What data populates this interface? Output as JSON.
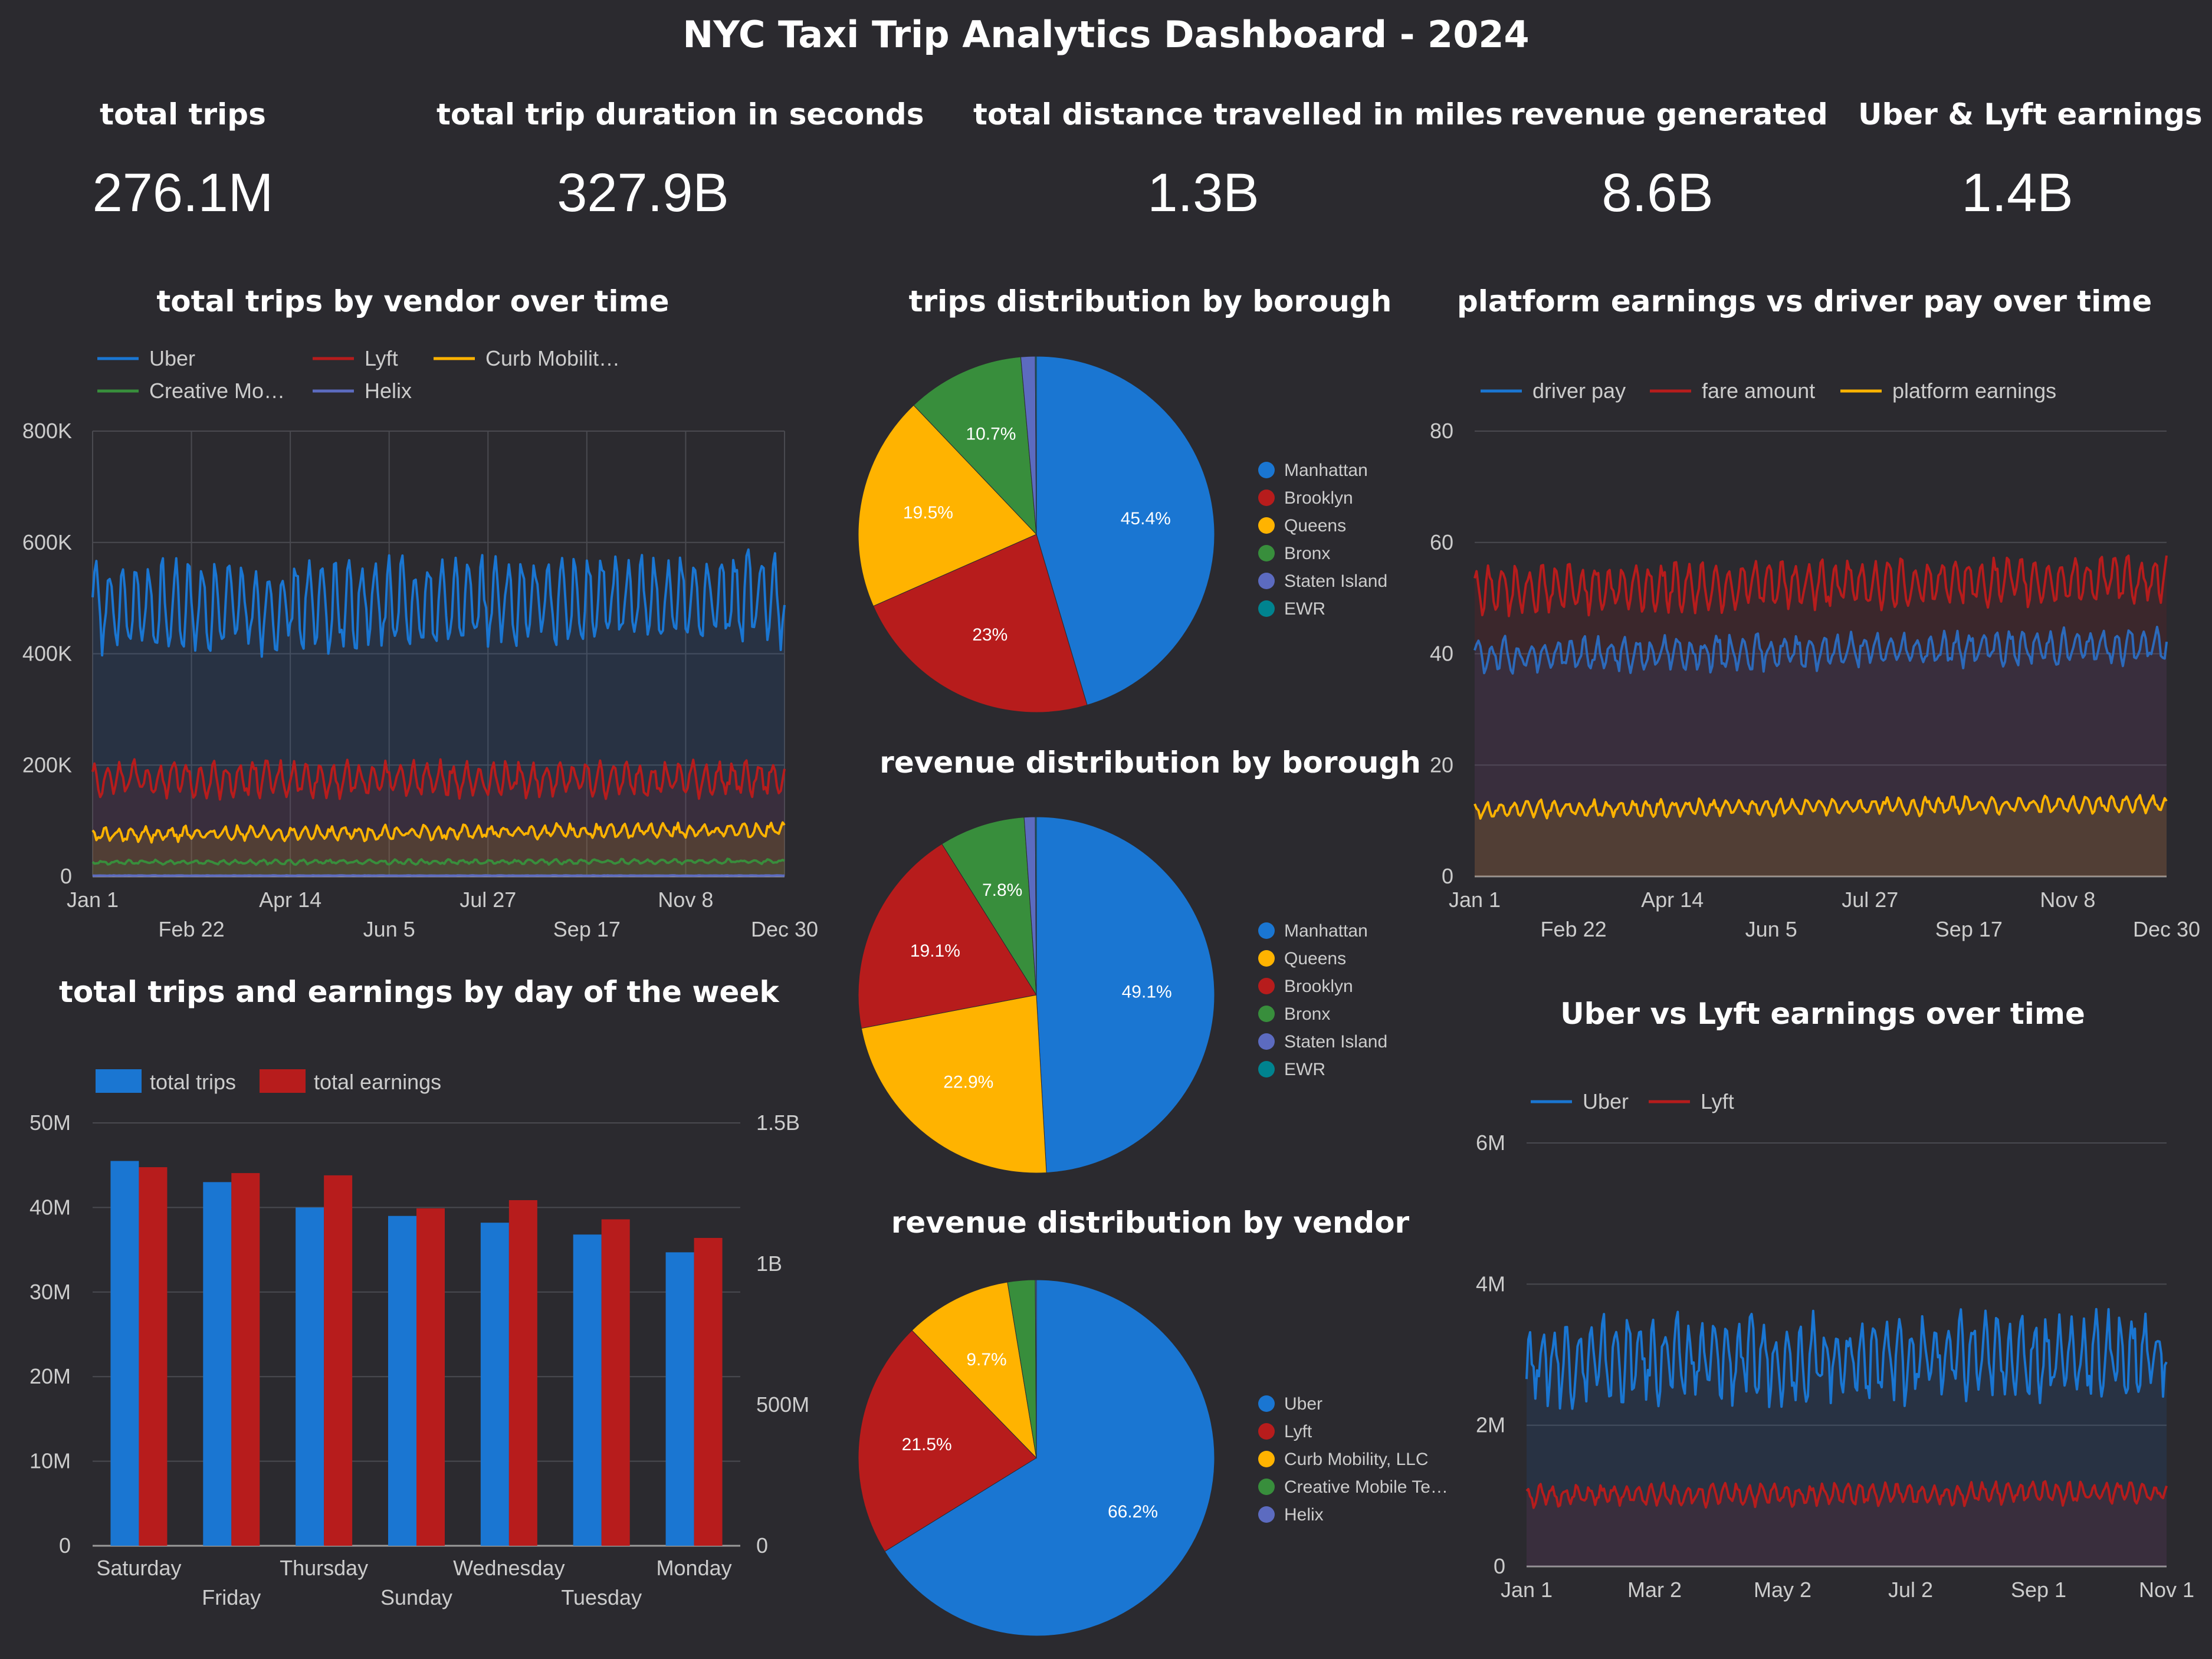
{
  "dashboard": {
    "title": "NYC Taxi Trip Analytics Dashboard - 2024",
    "kpis": [
      {
        "label": "total trips",
        "value": "276.1M"
      },
      {
        "label": "total trip duration in seconds",
        "value": "327.9B"
      },
      {
        "label": "total distance travelled in miles",
        "value": "1.3B"
      },
      {
        "label": "revenue generated",
        "value": "8.6B"
      },
      {
        "label": "Uber & Lyft earnings",
        "value": "1.4B"
      }
    ]
  },
  "colors": {
    "background": "#2b2a2f",
    "blue": "#1a76d2",
    "red": "#b71c1c",
    "yellow": "#ffb300",
    "green": "#388e3c",
    "purple": "#5c6bc0",
    "teal": "#00838f",
    "grid": "#4a4a50",
    "axis_text": "#cccccc"
  },
  "chart_data": [
    {
      "id": "trips_by_vendor",
      "type": "line",
      "title": "total trips by vendor over time",
      "x_ticks": [
        "Jan 1",
        "Feb 22",
        "Apr 14",
        "Jun 5",
        "Jul 27",
        "Sep 17",
        "Nov 8",
        "Dec 30"
      ],
      "y_ticks": [
        "0",
        "200K",
        "400K",
        "600K",
        "800K"
      ],
      "ylim": [
        0,
        800000
      ],
      "grid": true,
      "legend_position": "top",
      "series": [
        {
          "name": "Uber",
          "color": "#1a76d2",
          "base": 480000,
          "weekly_amp": 70000,
          "noise": 25000,
          "trend": 20000
        },
        {
          "name": "Lyft",
          "color": "#b71c1c",
          "base": 175000,
          "weekly_amp": 25000,
          "noise": 12000,
          "trend": 0
        },
        {
          "name": "Curb Mobilit…",
          "color": "#ffb300",
          "base": 75000,
          "weekly_amp": 10000,
          "noise": 6000,
          "trend": 8000
        },
        {
          "name": "Creative Mo…",
          "color": "#388e3c",
          "base": 25000,
          "weekly_amp": 3000,
          "noise": 2000,
          "trend": 2000
        },
        {
          "name": "Helix",
          "color": "#5c6bc0",
          "base": 1500,
          "weekly_amp": 200,
          "noise": 200,
          "trend": 0
        }
      ]
    },
    {
      "id": "trips_by_borough",
      "type": "pie",
      "title": "trips distribution by borough",
      "slices": [
        {
          "label": "Manhattan",
          "value": 45.4,
          "color": "#1a76d2",
          "pct_label": "45.4%"
        },
        {
          "label": "Brooklyn",
          "value": 23.0,
          "color": "#b71c1c",
          "pct_label": "23%"
        },
        {
          "label": "Queens",
          "value": 19.5,
          "color": "#ffb300",
          "pct_label": "19.5%"
        },
        {
          "label": "Bronx",
          "value": 10.7,
          "color": "#388e3c",
          "pct_label": "10.7%"
        },
        {
          "label": "Staten Island",
          "value": 1.3,
          "color": "#5c6bc0",
          "pct_label": ""
        },
        {
          "label": "EWR",
          "value": 0.1,
          "color": "#00838f",
          "pct_label": ""
        }
      ]
    },
    {
      "id": "revenue_by_borough",
      "type": "pie",
      "title": "revenue distribution by borough",
      "slices": [
        {
          "label": "Manhattan",
          "value": 49.1,
          "color": "#1a76d2",
          "pct_label": "49.1%"
        },
        {
          "label": "Queens",
          "value": 22.9,
          "color": "#ffb300",
          "pct_label": "22.9%"
        },
        {
          "label": "Brooklyn",
          "value": 19.1,
          "color": "#b71c1c",
          "pct_label": "19.1%"
        },
        {
          "label": "Bronx",
          "value": 7.8,
          "color": "#388e3c",
          "pct_label": "7.8%"
        },
        {
          "label": "Staten Island",
          "value": 1.0,
          "color": "#5c6bc0",
          "pct_label": ""
        },
        {
          "label": "EWR",
          "value": 0.1,
          "color": "#00838f",
          "pct_label": ""
        }
      ]
    },
    {
      "id": "revenue_by_vendor",
      "type": "pie",
      "title": "revenue distribution by vendor",
      "slices": [
        {
          "label": "Uber",
          "value": 66.2,
          "color": "#1a76d2",
          "pct_label": "66.2%"
        },
        {
          "label": "Lyft",
          "value": 21.5,
          "color": "#b71c1c",
          "pct_label": "21.5%"
        },
        {
          "label": "Curb Mobility, LLC",
          "value": 9.7,
          "color": "#ffb300",
          "pct_label": "9.7%"
        },
        {
          "label": "Creative Mobile Te…",
          "value": 2.5,
          "color": "#388e3c",
          "pct_label": ""
        },
        {
          "label": "Helix",
          "value": 0.1,
          "color": "#5c6bc0",
          "pct_label": ""
        }
      ]
    },
    {
      "id": "earnings_vs_driver_pay",
      "type": "line",
      "title": "platform earnings vs driver pay over time",
      "x_ticks": [
        "Jan 1",
        "Feb 22",
        "Apr 14",
        "Jun 5",
        "Jul 27",
        "Sep 17",
        "Nov 8",
        "Dec 30"
      ],
      "y_ticks": [
        "0",
        "20",
        "40",
        "60",
        "80"
      ],
      "ylim": [
        0,
        80
      ],
      "grid": true,
      "legend_position": "top",
      "series": [
        {
          "name": "driver pay",
          "color": "#1a76d2",
          "base": 39.5,
          "weekly_amp": 2.5,
          "noise": 1.2,
          "trend": 2
        },
        {
          "name": "fare amount",
          "color": "#b71c1c",
          "base": 51.5,
          "weekly_amp": 3.5,
          "noise": 1.5,
          "trend": 2
        },
        {
          "name": "platform earnings",
          "color": "#ffb300",
          "base": 12,
          "weekly_amp": 1.2,
          "noise": 0.6,
          "trend": 1
        }
      ]
    },
    {
      "id": "trips_earnings_by_weekday",
      "type": "bar",
      "title": "total trips and earnings by day of the week",
      "categories": [
        "Saturday",
        "Friday",
        "Thursday",
        "Sunday",
        "Wednesday",
        "Tuesday",
        "Monday"
      ],
      "y_ticks_left": [
        "0",
        "10M",
        "20M",
        "30M",
        "40M",
        "50M"
      ],
      "y_ticks_right": [
        "0",
        "500M",
        "1B",
        "1.5B"
      ],
      "ylim_left": [
        0,
        50000000
      ],
      "ylim_right": [
        0,
        1500000000
      ],
      "legend_position": "top",
      "series": [
        {
          "name": "total trips",
          "color": "#1a76d2",
          "axis": "left",
          "values": [
            45500000,
            43000000,
            40000000,
            39000000,
            38200000,
            36800000,
            34700000
          ]
        },
        {
          "name": "total earnings",
          "color": "#b71c1c",
          "axis": "right",
          "values": [
            1343000000,
            1322000000,
            1314000000,
            1197000000,
            1226000000,
            1158000000,
            1092000000
          ]
        }
      ]
    },
    {
      "id": "uber_vs_lyft_earnings",
      "type": "line",
      "title": "Uber vs Lyft earnings over time",
      "x_ticks": [
        "Jan 1",
        "Mar 2",
        "May 2",
        "Jul 2",
        "Sep 1",
        "Nov 1"
      ],
      "y_ticks": [
        "0",
        "2M",
        "4M",
        "6M"
      ],
      "ylim": [
        0,
        6000000
      ],
      "grid": true,
      "legend_position": "top",
      "series": [
        {
          "name": "Uber",
          "color": "#1a76d2",
          "base": 2900000,
          "weekly_amp": 450000,
          "noise": 250000,
          "trend": 100000
        },
        {
          "name": "Lyft",
          "color": "#b71c1c",
          "base": 1000000,
          "weekly_amp": 120000,
          "noise": 60000,
          "trend": 50000
        }
      ]
    }
  ]
}
